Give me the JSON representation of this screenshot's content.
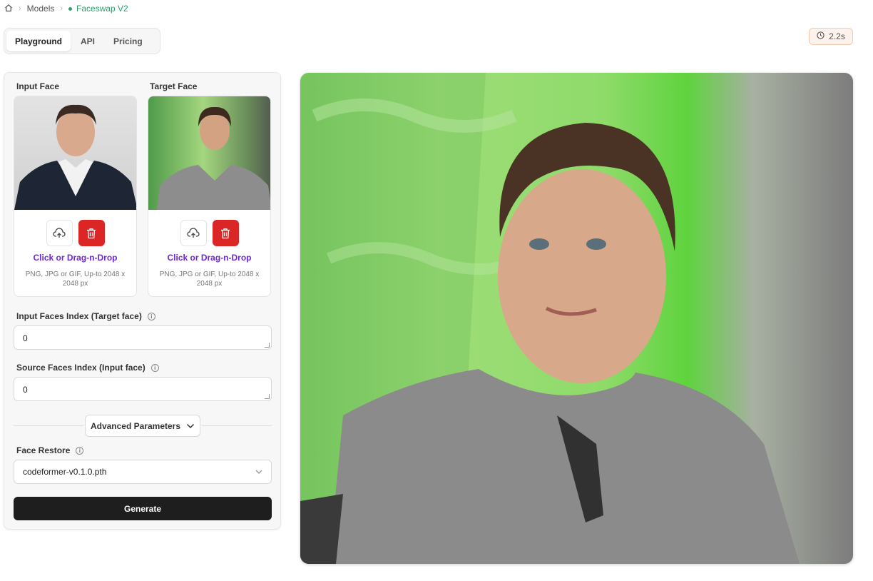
{
  "breadcrumb": {
    "home_icon": "home-icon",
    "items": [
      "Models",
      "Faceswap V2"
    ]
  },
  "tabs": [
    {
      "label": "Playground",
      "active": true
    },
    {
      "label": "API",
      "active": false
    },
    {
      "label": "Pricing",
      "active": false
    }
  ],
  "timing": {
    "icon": "clock-icon",
    "value": "2.2s"
  },
  "uploads": [
    {
      "label": "Input Face",
      "drop_text": "Click or Drag-n-Drop",
      "hint": "PNG, JPG or GIF, Up-to 2048 x 2048 px"
    },
    {
      "label": "Target Face",
      "drop_text": "Click or Drag-n-Drop",
      "hint": "PNG, JPG or GIF, Up-to 2048 x 2048 px"
    }
  ],
  "fields": {
    "input_faces_index": {
      "label": "Input Faces Index (Target face)",
      "value": "0"
    },
    "source_faces_index": {
      "label": "Source Faces Index (Input face)",
      "value": "0"
    }
  },
  "advanced": {
    "label": "Advanced Parameters"
  },
  "face_restore": {
    "label": "Face Restore",
    "value": "codeformer-v0.1.0.pth"
  },
  "generate": {
    "label": "Generate"
  },
  "colors": {
    "accent_green": "#2ea06a",
    "delete_red": "#dc2626",
    "link_purple": "#6d28d9",
    "primary_dark": "#1e1e1e"
  }
}
